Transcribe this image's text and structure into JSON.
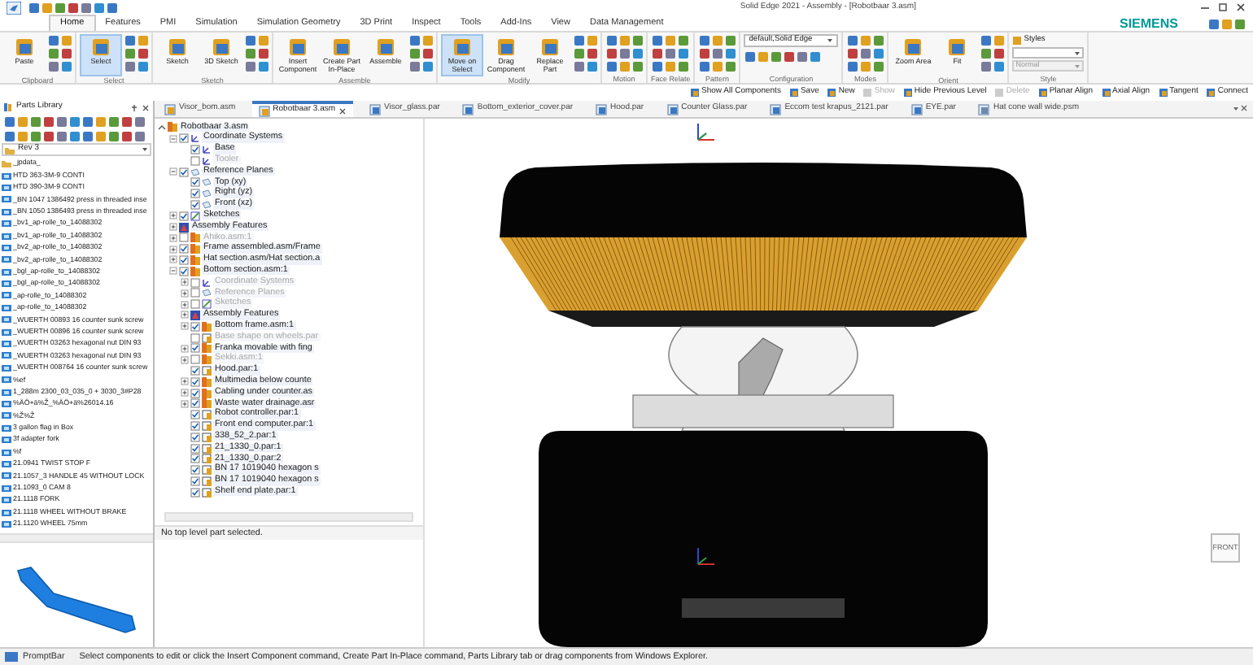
{
  "window": {
    "title": "Solid Edge 2021 - Assembly - [Robotbaar 3.asm]",
    "brand": "SIEMENS"
  },
  "menu_tabs": [
    {
      "label": "Home",
      "selected": true
    },
    {
      "label": "Features",
      "selected": false
    },
    {
      "label": "PMI",
      "selected": false
    },
    {
      "label": "Simulation",
      "selected": false
    },
    {
      "label": "Simulation Geometry",
      "selected": false
    },
    {
      "label": "3D Print",
      "selected": false
    },
    {
      "label": "Inspect",
      "selected": false
    },
    {
      "label": "Tools",
      "selected": false
    },
    {
      "label": "Add-Ins",
      "selected": false
    },
    {
      "label": "View",
      "selected": false
    },
    {
      "label": "Data Management",
      "selected": false
    }
  ],
  "ribbon": {
    "groups": [
      {
        "label": "Clipboard",
        "buttons": [
          {
            "label": "Paste",
            "selected": false
          }
        ]
      },
      {
        "label": "Select",
        "buttons": [
          {
            "label": "Select",
            "selected": true
          }
        ]
      },
      {
        "label": "Sketch",
        "buttons": [
          {
            "label": "Sketch",
            "selected": false
          },
          {
            "label": "3D Sketch",
            "selected": false
          }
        ]
      },
      {
        "label": "Assemble",
        "buttons": [
          {
            "label": "Insert Component",
            "selected": false
          },
          {
            "label": "Create Part In-Place",
            "selected": false
          },
          {
            "label": "Assemble",
            "selected": false
          }
        ]
      },
      {
        "label": "Modify",
        "buttons": [
          {
            "label": "Move on Select",
            "selected": true
          },
          {
            "label": "Drag Component",
            "selected": false
          },
          {
            "label": "Replace Part",
            "selected": false
          }
        ]
      },
      {
        "label": "Motion"
      },
      {
        "label": "Face Relate"
      },
      {
        "label": "Pattern"
      },
      {
        "label": "Configuration",
        "combo": "default,Solid Edge"
      },
      {
        "label": "Modes"
      },
      {
        "label": "Orient",
        "buttons": [
          {
            "label": "Zoom Area",
            "selected": false
          },
          {
            "label": "Fit",
            "selected": false
          }
        ]
      },
      {
        "label": "Style",
        "styles_label": "Styles",
        "combo_value": "Normal"
      }
    ]
  },
  "command_bar": [
    {
      "label": "Show All Components",
      "disabled": false
    },
    {
      "label": "Save",
      "disabled": false
    },
    {
      "label": "New",
      "disabled": false
    },
    {
      "label": "Show",
      "disabled": true
    },
    {
      "label": "Hide Previous Level",
      "disabled": false
    },
    {
      "label": "Delete",
      "disabled": true
    },
    {
      "label": "Planar Align",
      "disabled": false
    },
    {
      "label": "Axial Align",
      "disabled": false
    },
    {
      "label": "Tangent",
      "disabled": false
    },
    {
      "label": "Connect",
      "disabled": false
    }
  ],
  "parts_library": {
    "title": "Parts Library",
    "folder": "Rev 3",
    "items": [
      {
        "label": "_jpdata_",
        "kind": "folder"
      },
      {
        "label": "HTD 363-3M-9 CONTI",
        "kind": "part"
      },
      {
        "label": "HTD 390-3M-9 CONTI",
        "kind": "part"
      },
      {
        "label": "_BN 1047 1386492 press in threaded inse",
        "kind": "part"
      },
      {
        "label": "_BN 1050 1386493 press in threaded inse",
        "kind": "part"
      },
      {
        "label": "_bv1_ap-rolle_to_14088302",
        "kind": "part"
      },
      {
        "label": "_bv1_ap-rolle_to_14088302",
        "kind": "part"
      },
      {
        "label": "_bv2_ap-rolle_to_14088302",
        "kind": "part"
      },
      {
        "label": "_bv2_ap-rolle_to_14088302",
        "kind": "part"
      },
      {
        "label": "_bgl_ap-rolle_to_14088302",
        "kind": "part"
      },
      {
        "label": "_bgl_ap-rolle_to_14088302",
        "kind": "part"
      },
      {
        "label": "_ap-rolle_to_14088302",
        "kind": "part"
      },
      {
        "label": "_ap-rolle_to_14088302",
        "kind": "part"
      },
      {
        "label": "_WUERTH 00893 16 counter sunk screw",
        "kind": "part"
      },
      {
        "label": "_WUERTH 00896 16 counter sunk screw",
        "kind": "part"
      },
      {
        "label": "_WUERTH 03263 hexagonal nut DIN 93",
        "kind": "part"
      },
      {
        "label": "_WUERTH 03263 hexagonal nut DIN 93",
        "kind": "part"
      },
      {
        "label": "_WUERTH 008764 16 counter sunk screw",
        "kind": "part"
      },
      {
        "label": "%ef",
        "kind": "part"
      },
      {
        "label": "1_288m 2300_03_035_0 + 3030_3#P28",
        "kind": "part"
      },
      {
        "label": "%ÄÖ+ä%Ž_%ÄÖ+ä%26014.16",
        "kind": "part"
      },
      {
        "label": "%Ž%Ž",
        "kind": "part"
      },
      {
        "label": "3 gallon flag in Box",
        "kind": "part"
      },
      {
        "label": "3f adapter fork",
        "kind": "part"
      },
      {
        "label": "%f",
        "kind": "part"
      },
      {
        "label": "21.0941 TWIST STOP F",
        "kind": "part"
      },
      {
        "label": "21.1057_3 HANDLE 45 WITHOUT LOCK",
        "kind": "part"
      },
      {
        "label": "21.1093_0 CAM 8",
        "kind": "part"
      },
      {
        "label": "21.1118 FORK",
        "kind": "part"
      },
      {
        "label": "21.1118 WHEEL WITHOUT BRAKE",
        "kind": "part"
      },
      {
        "label": "21.1120 WHEEL 75mm",
        "kind": "part"
      }
    ]
  },
  "document_tabs": [
    {
      "label": "Visor_bom.asm",
      "kind": "assembly",
      "selected": false
    },
    {
      "label": "Robotbaar 3.asm",
      "kind": "assembly",
      "selected": true
    },
    {
      "label": "Visor_glass.par",
      "kind": "part",
      "selected": false
    },
    {
      "label": "Bottom_exterior_cover.par",
      "kind": "part",
      "selected": false
    },
    {
      "label": "Hood.par",
      "kind": "part",
      "selected": false
    },
    {
      "label": "Counter Glass.par",
      "kind": "part",
      "selected": false
    },
    {
      "label": "Eccom test krapus_2121.par",
      "kind": "part",
      "selected": false
    },
    {
      "label": "EYE.par",
      "kind": "part",
      "selected": false
    },
    {
      "label": "Hat cone wall wide.psm",
      "kind": "sheet",
      "selected": false
    }
  ],
  "tree": {
    "items": [
      {
        "label": "Robotbaar 3.asm",
        "kind": "root",
        "expanded": true,
        "children": [
          {
            "label": "Coordinate Systems",
            "kind": "coordinates",
            "checked": true,
            "expanded": true,
            "children": [
              {
                "label": "Base",
                "kind": "coordinates",
                "checked": true
              },
              {
                "label": "Tooler",
                "kind": "coordinates",
                "checked": false
              }
            ]
          },
          {
            "label": "Reference Planes",
            "kind": "plane",
            "checked": true,
            "expanded": true,
            "children": [
              {
                "label": "Top (xy)",
                "kind": "plane",
                "checked": true
              },
              {
                "label": "Right (yz)",
                "kind": "plane",
                "checked": true
              },
              {
                "label": "Front (xz)",
                "kind": "plane",
                "checked": true
              }
            ]
          },
          {
            "label": "Sketches",
            "kind": "sketch",
            "checked": true,
            "expanded": false
          },
          {
            "label": "Assembly Features",
            "kind": "features",
            "expanded": false
          },
          {
            "label": "Ahiko.asm:1",
            "kind": "assembly",
            "checked": false,
            "expanded": false
          },
          {
            "label": "Frame assembled.asm/Frame",
            "kind": "assembly",
            "checked": true,
            "expanded": false
          },
          {
            "label": "Hat section.asm/Hat section.a",
            "kind": "assembly",
            "checked": true,
            "expanded": false
          },
          {
            "label": "Bottom section.asm:1",
            "kind": "assembly",
            "checked": true,
            "expanded": true,
            "children": [
              {
                "label": "Coordinate Systems",
                "kind": "coordinates",
                "checked": false,
                "expanded": false
              },
              {
                "label": "Reference Planes",
                "kind": "plane",
                "checked": false,
                "expanded": false
              },
              {
                "label": "Sketches",
                "kind": "sketch",
                "checked": false,
                "expanded": false
              },
              {
                "label": "Assembly Features",
                "kind": "features",
                "expanded": false
              },
              {
                "label": "Bottom frame.asm:1",
                "kind": "assembly",
                "checked": true,
                "expanded": false
              },
              {
                "label": "Base shape on wheels.par",
                "kind": "part",
                "checked": false
              },
              {
                "label": "Franka movable with fing",
                "kind": "assembly",
                "checked": true,
                "expanded": false
              },
              {
                "label": "Sekki.asm:1",
                "kind": "assembly",
                "checked": false,
                "expanded": false
              },
              {
                "label": "Hood.par:1",
                "kind": "part",
                "checked": true
              },
              {
                "label": "Multimedia below counte",
                "kind": "assembly",
                "checked": true,
                "expanded": false
              },
              {
                "label": "Cabling under counter.as",
                "kind": "assembly",
                "checked": true,
                "expanded": false
              },
              {
                "label": "Waste water drainage.asr",
                "kind": "assembly",
                "checked": true,
                "expanded": false
              },
              {
                "label": "Robot controller.par:1",
                "kind": "part",
                "checked": true
              },
              {
                "label": "Front end computer.par:1",
                "kind": "part",
                "checked": true
              },
              {
                "label": "338_52_2.par:1",
                "kind": "part",
                "checked": true
              },
              {
                "label": "21_1330_0.par:1",
                "kind": "part",
                "checked": true
              },
              {
                "label": "21_1330_0.par:2",
                "kind": "part",
                "checked": true
              },
              {
                "label": "BN 17 1019040 hexagon s",
                "kind": "part",
                "checked": true
              },
              {
                "label": "BN 17 1019040 hexagon s",
                "kind": "part",
                "checked": true
              },
              {
                "label": "Shelf end plate.par:1",
                "kind": "part",
                "checked": true
              }
            ]
          }
        ]
      }
    ],
    "status": "No top level part selected."
  },
  "viewport": {
    "view_cube": "FRONT"
  },
  "prompt_bar": {
    "label": "PromptBar",
    "text": "Select components to edit or click the Insert Component command, Create Part In-Place command, Parts Library tab or drag components from Windows Explorer."
  }
}
